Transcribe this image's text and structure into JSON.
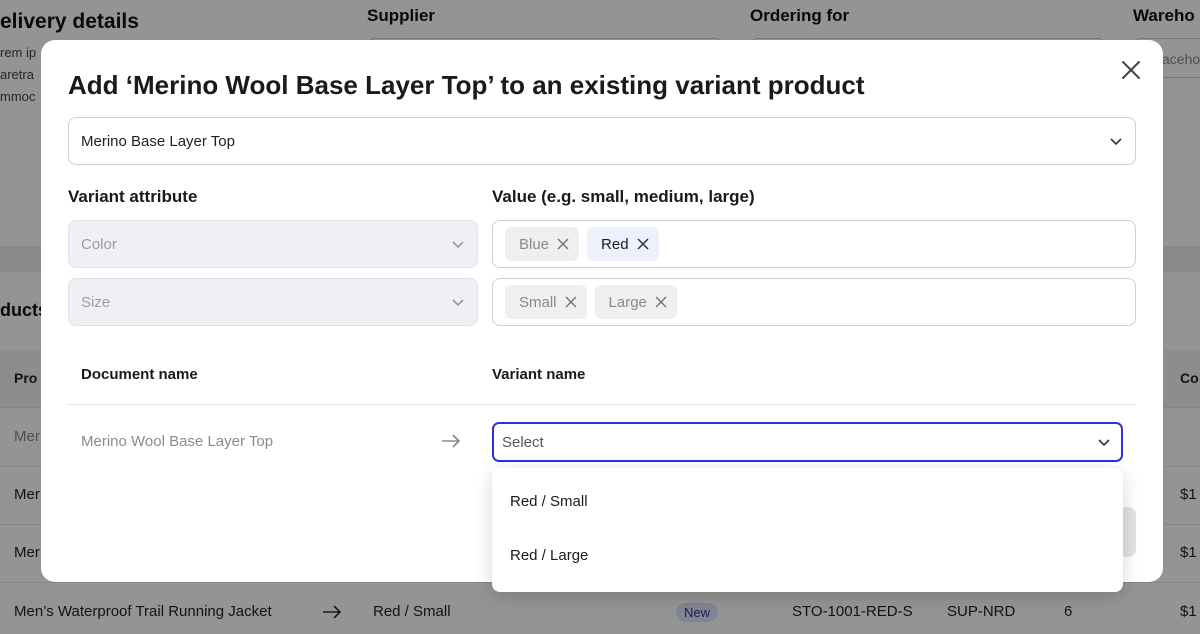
{
  "background": {
    "section_title": "elivery details",
    "lorem_lines": [
      "rem ip",
      "aretra",
      "mmoc"
    ],
    "columns": {
      "supplier": "Supplier",
      "ordering_for": "Ordering for",
      "warehouse": "Wareho"
    },
    "warehouse_placeholder": "aceho",
    "products_heading": "ducts",
    "table_headers": {
      "product": "Pro",
      "cost": "Co"
    },
    "rows": [
      {
        "product": "Mer",
        "cost": ""
      },
      {
        "product": "Mer",
        "cost": "$1"
      },
      {
        "product": "Mer",
        "cost": "$1"
      }
    ],
    "last_row": {
      "product": "Men’s Waterproof Trail Running Jacket",
      "variant": "Red / Small",
      "badge": "New",
      "sku": "STO-1001-RED-S",
      "supplier_code": "SUP-NRD",
      "quantity": "6",
      "cost": "$1"
    }
  },
  "modal": {
    "title": "Add ‘Merino Wool Base Layer Top’ to an existing variant product",
    "product_select": {
      "value": "Merino Base Layer Top"
    },
    "attribute_label": "Variant attribute",
    "value_label": "Value (e.g. small, medium, large)",
    "attributes": [
      {
        "name": "Color",
        "tags": [
          {
            "label": "Blue",
            "active": false
          },
          {
            "label": "Red",
            "active": true
          }
        ]
      },
      {
        "name": "Size",
        "tags": [
          {
            "label": "Small",
            "active": false
          },
          {
            "label": "Large",
            "active": false
          }
        ]
      }
    ],
    "table": {
      "document_name_header": "Document name",
      "variant_name_header": "Variant name",
      "rows": [
        {
          "document_name": "Merino Wool Base Layer Top",
          "variant_placeholder": "Select"
        }
      ]
    },
    "dropdown_options": [
      "Red / Small",
      "Red / Large"
    ]
  },
  "colors": {
    "accent": "#2f2fe0",
    "overlay": "rgba(0,0,0,0.42)",
    "active_tag_bg": "#eef0fb",
    "badge_bg": "#dfe6fb"
  }
}
